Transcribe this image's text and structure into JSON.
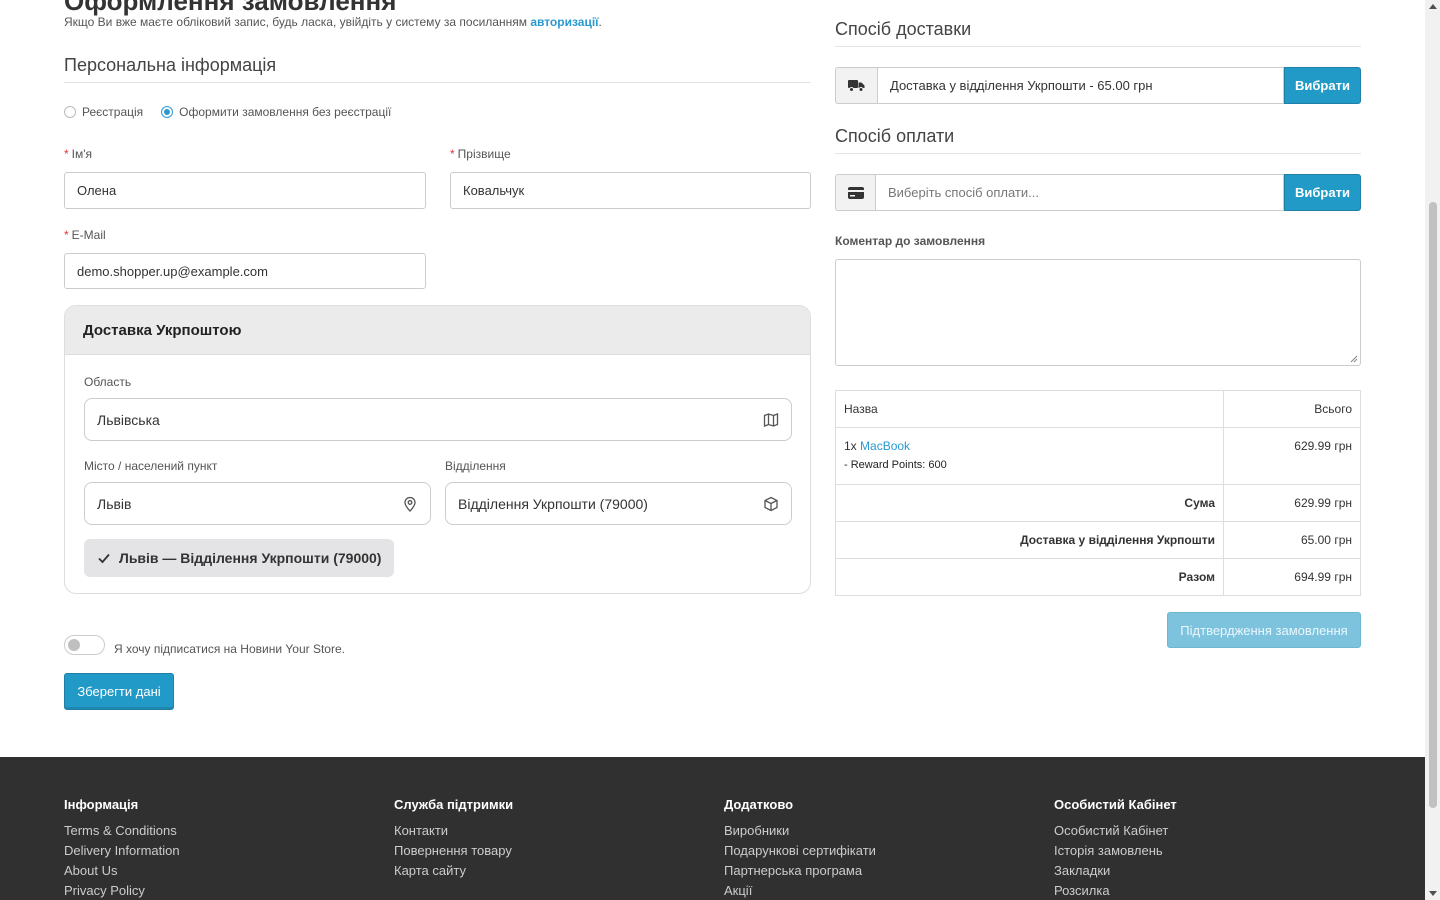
{
  "checkout": {
    "heading_partial": "Оформлення замовлення",
    "login_note_prefix": "Якщо Ви вже маєте обліковий запис, будь ласка, увійдіть у систему за посиланням ",
    "login_link": "авторизації",
    "login_note_suffix": ".",
    "personal_title": "Персональна інформація",
    "radio_register": "Реєстрація",
    "radio_guest": "Оформити замовлення без реєстрації",
    "firstname_label": "Ім'я",
    "firstname_value": "Олена",
    "lastname_label": "Прізвище",
    "lastname_value": "Ковальчук",
    "email_label": "E-Mail",
    "email_value": "demo.shopper.up@example.com"
  },
  "ukrposhta": {
    "title": "Доставка Укрпоштою",
    "region_label": "Область",
    "region_value": "Львівська",
    "city_label": "Місто / населений пункт",
    "city_value": "Львів",
    "branch_label": "Відділення",
    "branch_value": "Відділення Укрпошти (79000)",
    "selected_text": "Львів — Відділення Укрпошти (79000)"
  },
  "newsletter": {
    "label": "Я хочу підписатися на Новини Your Store."
  },
  "save_button": "Зберегти дані",
  "shipping": {
    "title": "Спосіб доставки",
    "value": "Доставка у відділення Укрпошти - 65.00 грн",
    "button": "Вибрати"
  },
  "payment": {
    "title": "Спосіб оплати",
    "placeholder": "Виберіть спосіб оплати...",
    "button": "Вибрати"
  },
  "comment": {
    "label": "Коментар до замовлення"
  },
  "order": {
    "col_name": "Назва",
    "col_total": "Всього",
    "item_qty": "1x",
    "item_name": "MacBook",
    "item_reward": "- Reward Points: 600",
    "item_total": "629.99 грн",
    "subtotal_label": "Сума",
    "subtotal_value": "629.99 грн",
    "shipping_label": "Доставка у відділення Укрпошти",
    "shipping_value": "65.00 грн",
    "total_label": "Разом",
    "total_value": "694.99 грн"
  },
  "confirm_button": "Підтвердження замовлення",
  "footer": {
    "info_title": "Інформація",
    "info_links": [
      "Terms & Conditions",
      "Delivery Information",
      "About Us",
      "Privacy Policy"
    ],
    "support_title": "Служба підтримки",
    "support_links": [
      "Контакти",
      "Повернення товару",
      "Карта сайту"
    ],
    "extra_title": "Додатково",
    "extra_links": [
      "Виробники",
      "Подарункові сертифікати",
      "Партнерська програма",
      "Акції"
    ],
    "account_title": "Особистий Кабінет",
    "account_links": [
      "Особистий Кабінет",
      "Історія замовлень",
      "Закладки",
      "Розсилка"
    ]
  }
}
